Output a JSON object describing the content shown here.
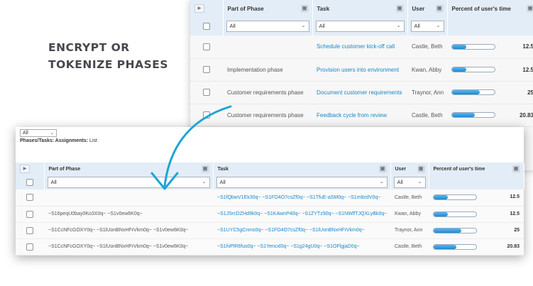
{
  "heading": {
    "line1": "ENCRYPT OR",
    "line2": "TOKENIZE PHASES"
  },
  "colors": {
    "accent": "#1a86c8",
    "header_bg": "#e3edf7",
    "arrow": "#1fa3d8"
  },
  "original_grid": {
    "columns": [
      "Part of Phase",
      "Task",
      "User",
      "Percent of user's time"
    ],
    "filters": {
      "phase": "All",
      "task": "All",
      "user": "All"
    },
    "rows": [
      {
        "phase": "",
        "task": "Schedule customer kick-off call",
        "user": "Castle, Beth",
        "percent": "12.5",
        "percent_value": 12.5
      },
      {
        "phase": "Implementation phase",
        "task": "Provision users into environment",
        "user": "Kwan, Abby",
        "percent": "12.5",
        "percent_value": 12.5
      },
      {
        "phase": "Customer requirements phase",
        "task": "Document customer requirements",
        "user": "Traynor, Ann",
        "percent": "25",
        "percent_value": 25
      },
      {
        "phase": "Customer requirements phase",
        "task": "Feedback cycle from review",
        "user": "Castle, Beth",
        "percent": "20.83",
        "percent_value": 20.83
      }
    ]
  },
  "encrypted_grid": {
    "view_select": "All",
    "breadcrumb_label": "Phases/Tasks: Assignments:",
    "breadcrumb_value": "List",
    "columns": [
      "Part of Phase",
      "Task",
      "User",
      "Percent of user's time"
    ],
    "filters": {
      "phase": "All",
      "task": "All",
      "user": "All"
    },
    "rows": [
      {
        "phase": "",
        "task": "~S1fQbwV1Ek30q~ ~S1FO4O7csZf0q~ ~S1TfuE-aSM0q~ ~S1m8zdV0q~",
        "user": "Castle, Beth",
        "percent": "12.5",
        "percent_value": 12.5
      },
      {
        "phase": "~S16peqU0bay0Ko3X0q~ ~S1v0ew6K0q~",
        "task": "~S1JSrcDZHd9k0q~ ~S1KAwnP40q~ ~S1ZYTz90q~ ~S1NWlfTJQXLyBk0q~",
        "user": "Kwan, Abby",
        "percent": "12.5",
        "percent_value": 12.5
      },
      {
        "phase": "~S1CcNFcGOXY0q~ ~S1lUonBNxHFrVkm0q~ ~S1v0ew6K0q~",
        "task": "~S1UYC5gCnms0q~ ~S1FO4O7csZf0q~ ~S1lUonBNxHFrVkm0q~",
        "user": "Traynor, Ann",
        "percent": "25",
        "percent_value": 25
      },
      {
        "phase": "~S1CcNFcGOXY0q~ ~S1lUonBNxHFrVkm0q~ ~S1v0ew6K0q~",
        "task": "~S1hiPlR6fus0q~ ~S1Yencxl0q~ ~S1g24gU0q~ ~S1OFlgjaD0q~",
        "user": "Castle, Beth",
        "percent": "20.83",
        "percent_value": 20.83
      }
    ]
  }
}
